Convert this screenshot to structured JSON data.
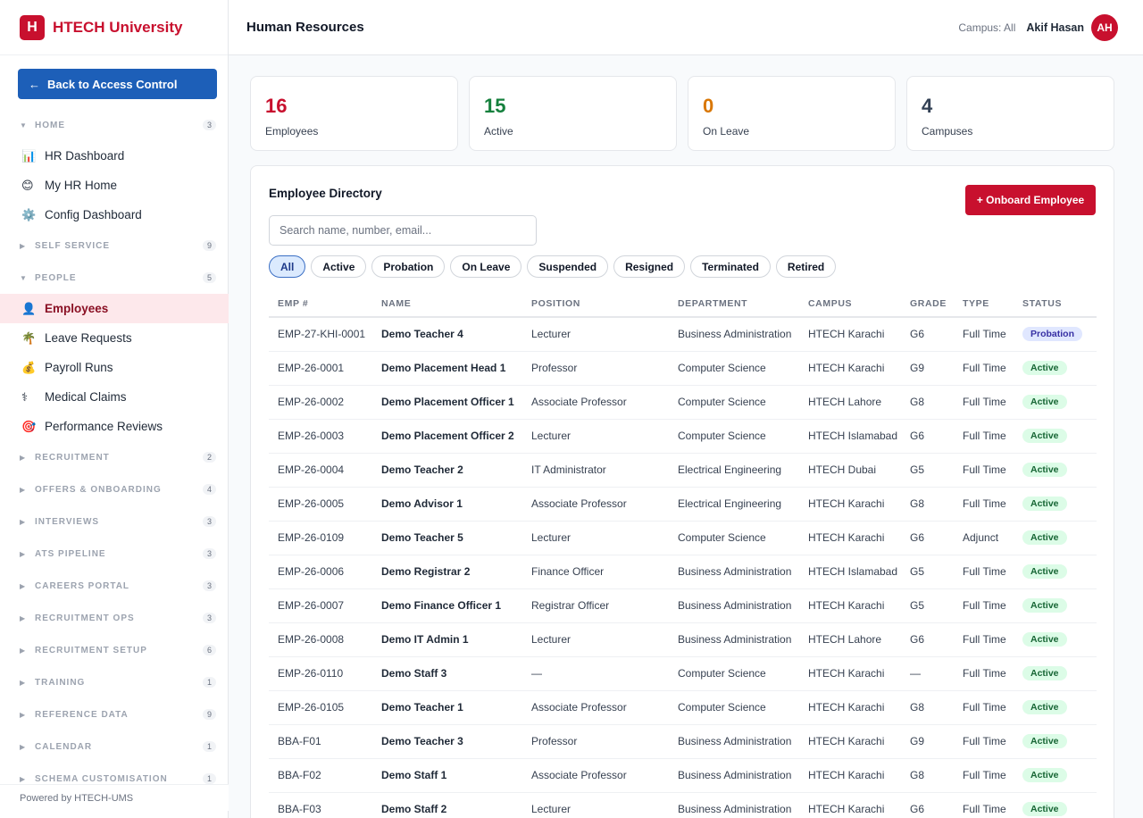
{
  "brand": {
    "logo_letter": "H",
    "name": "HTECH University",
    "color": "#c8102e"
  },
  "sidebar": {
    "back_label": "Back to Access Control",
    "back_arrow": "←",
    "sections": [
      {
        "title": "HOME",
        "count": "3",
        "expanded": true,
        "items": [
          {
            "label": "HR Dashboard",
            "icon": "📊"
          },
          {
            "label": "My HR Home",
            "icon": "😊"
          },
          {
            "label": "Config Dashboard",
            "icon": "⚙️"
          }
        ]
      },
      {
        "title": "SELF SERVICE",
        "count": "9",
        "expanded": false,
        "items": []
      },
      {
        "title": "PEOPLE",
        "count": "5",
        "expanded": true,
        "items": [
          {
            "label": "Employees",
            "icon": "👤",
            "active": true
          },
          {
            "label": "Leave Requests",
            "icon": "🌴"
          },
          {
            "label": "Payroll Runs",
            "icon": "💰"
          },
          {
            "label": "Medical Claims",
            "icon": "⚕"
          },
          {
            "label": "Performance Reviews",
            "icon": "🎯"
          }
        ]
      },
      {
        "title": "RECRUITMENT",
        "count": "2",
        "expanded": false,
        "items": []
      },
      {
        "title": "OFFERS & ONBOARDING",
        "count": "4",
        "expanded": false,
        "items": []
      },
      {
        "title": "INTERVIEWS",
        "count": "3",
        "expanded": false,
        "items": []
      },
      {
        "title": "ATS PIPELINE",
        "count": "3",
        "expanded": false,
        "items": []
      },
      {
        "title": "CAREERS PORTAL",
        "count": "3",
        "expanded": false,
        "items": []
      },
      {
        "title": "RECRUITMENT OPS",
        "count": "3",
        "expanded": false,
        "items": []
      },
      {
        "title": "RECRUITMENT SETUP",
        "count": "6",
        "expanded": false,
        "items": []
      },
      {
        "title": "TRAINING",
        "count": "1",
        "expanded": false,
        "items": []
      },
      {
        "title": "REFERENCE DATA",
        "count": "9",
        "expanded": false,
        "items": []
      },
      {
        "title": "CALENDAR",
        "count": "1",
        "expanded": false,
        "items": []
      },
      {
        "title": "SCHEMA CUSTOMISATION",
        "count": "1",
        "expanded": false,
        "items": []
      }
    ],
    "footer": "Powered by HTECH-UMS"
  },
  "header": {
    "title": "Human Resources",
    "campus": "Campus: All",
    "user_name": "Akif Hasan",
    "avatar_initials": "AH"
  },
  "stats": [
    {
      "value": "16",
      "label": "Employees",
      "color": "#c8102e"
    },
    {
      "value": "15",
      "label": "Active",
      "color": "#15803d"
    },
    {
      "value": "0",
      "label": "On Leave",
      "color": "#d97706"
    },
    {
      "value": "4",
      "label": "Campuses",
      "color": "#334155"
    }
  ],
  "directory": {
    "title": "Employee Directory",
    "onboard_label": "+ Onboard Employee",
    "search_placeholder": "Search name, number, email...",
    "filters": [
      "All",
      "Active",
      "Probation",
      "On Leave",
      "Suspended",
      "Resigned",
      "Terminated",
      "Retired"
    ],
    "active_filter": "All",
    "columns": [
      "EMP #",
      "NAME",
      "POSITION",
      "DEPARTMENT",
      "CAMPUS",
      "GRADE",
      "TYPE",
      "STATUS"
    ],
    "rows": [
      {
        "emp": "EMP-27-KHI-0001",
        "name": "Demo Teacher 4",
        "position": "Lecturer",
        "department": "Business Administration",
        "campus": "HTECH Karachi",
        "grade": "G6",
        "type": "Full Time",
        "status": "Probation"
      },
      {
        "emp": "EMP-26-0001",
        "name": "Demo Placement Head 1",
        "position": "Professor",
        "department": "Computer Science",
        "campus": "HTECH Karachi",
        "grade": "G9",
        "type": "Full Time",
        "status": "Active"
      },
      {
        "emp": "EMP-26-0002",
        "name": "Demo Placement Officer 1",
        "position": "Associate Professor",
        "department": "Computer Science",
        "campus": "HTECH Lahore",
        "grade": "G8",
        "type": "Full Time",
        "status": "Active"
      },
      {
        "emp": "EMP-26-0003",
        "name": "Demo Placement Officer 2",
        "position": "Lecturer",
        "department": "Computer Science",
        "campus": "HTECH Islamabad",
        "grade": "G6",
        "type": "Full Time",
        "status": "Active"
      },
      {
        "emp": "EMP-26-0004",
        "name": "Demo Teacher 2",
        "position": "IT Administrator",
        "department": "Electrical Engineering",
        "campus": "HTECH Dubai",
        "grade": "G5",
        "type": "Full Time",
        "status": "Active"
      },
      {
        "emp": "EMP-26-0005",
        "name": "Demo Advisor 1",
        "position": "Associate Professor",
        "department": "Electrical Engineering",
        "campus": "HTECH Karachi",
        "grade": "G8",
        "type": "Full Time",
        "status": "Active"
      },
      {
        "emp": "EMP-26-0109",
        "name": "Demo Teacher 5",
        "position": "Lecturer",
        "department": "Computer Science",
        "campus": "HTECH Karachi",
        "grade": "G6",
        "type": "Adjunct",
        "status": "Active"
      },
      {
        "emp": "EMP-26-0006",
        "name": "Demo Registrar 2",
        "position": "Finance Officer",
        "department": "Business Administration",
        "campus": "HTECH Islamabad",
        "grade": "G5",
        "type": "Full Time",
        "status": "Active"
      },
      {
        "emp": "EMP-26-0007",
        "name": "Demo Finance Officer 1",
        "position": "Registrar Officer",
        "department": "Business Administration",
        "campus": "HTECH Karachi",
        "grade": "G5",
        "type": "Full Time",
        "status": "Active"
      },
      {
        "emp": "EMP-26-0008",
        "name": "Demo IT Admin 1",
        "position": "Lecturer",
        "department": "Business Administration",
        "campus": "HTECH Lahore",
        "grade": "G6",
        "type": "Full Time",
        "status": "Active"
      },
      {
        "emp": "EMP-26-0110",
        "name": "Demo Staff 3",
        "position": "—",
        "department": "Computer Science",
        "campus": "HTECH Karachi",
        "grade": "—",
        "type": "Full Time",
        "status": "Active"
      },
      {
        "emp": "EMP-26-0105",
        "name": "Demo Teacher 1",
        "position": "Associate Professor",
        "department": "Computer Science",
        "campus": "HTECH Karachi",
        "grade": "G8",
        "type": "Full Time",
        "status": "Active"
      },
      {
        "emp": "BBA-F01",
        "name": "Demo Teacher 3",
        "position": "Professor",
        "department": "Business Administration",
        "campus": "HTECH Karachi",
        "grade": "G9",
        "type": "Full Time",
        "status": "Active"
      },
      {
        "emp": "BBA-F02",
        "name": "Demo Staff 1",
        "position": "Associate Professor",
        "department": "Business Administration",
        "campus": "HTECH Karachi",
        "grade": "G8",
        "type": "Full Time",
        "status": "Active"
      },
      {
        "emp": "BBA-F03",
        "name": "Demo Staff 2",
        "position": "Lecturer",
        "department": "Business Administration",
        "campus": "HTECH Karachi",
        "grade": "G6",
        "type": "Full Time",
        "status": "Active"
      }
    ]
  }
}
